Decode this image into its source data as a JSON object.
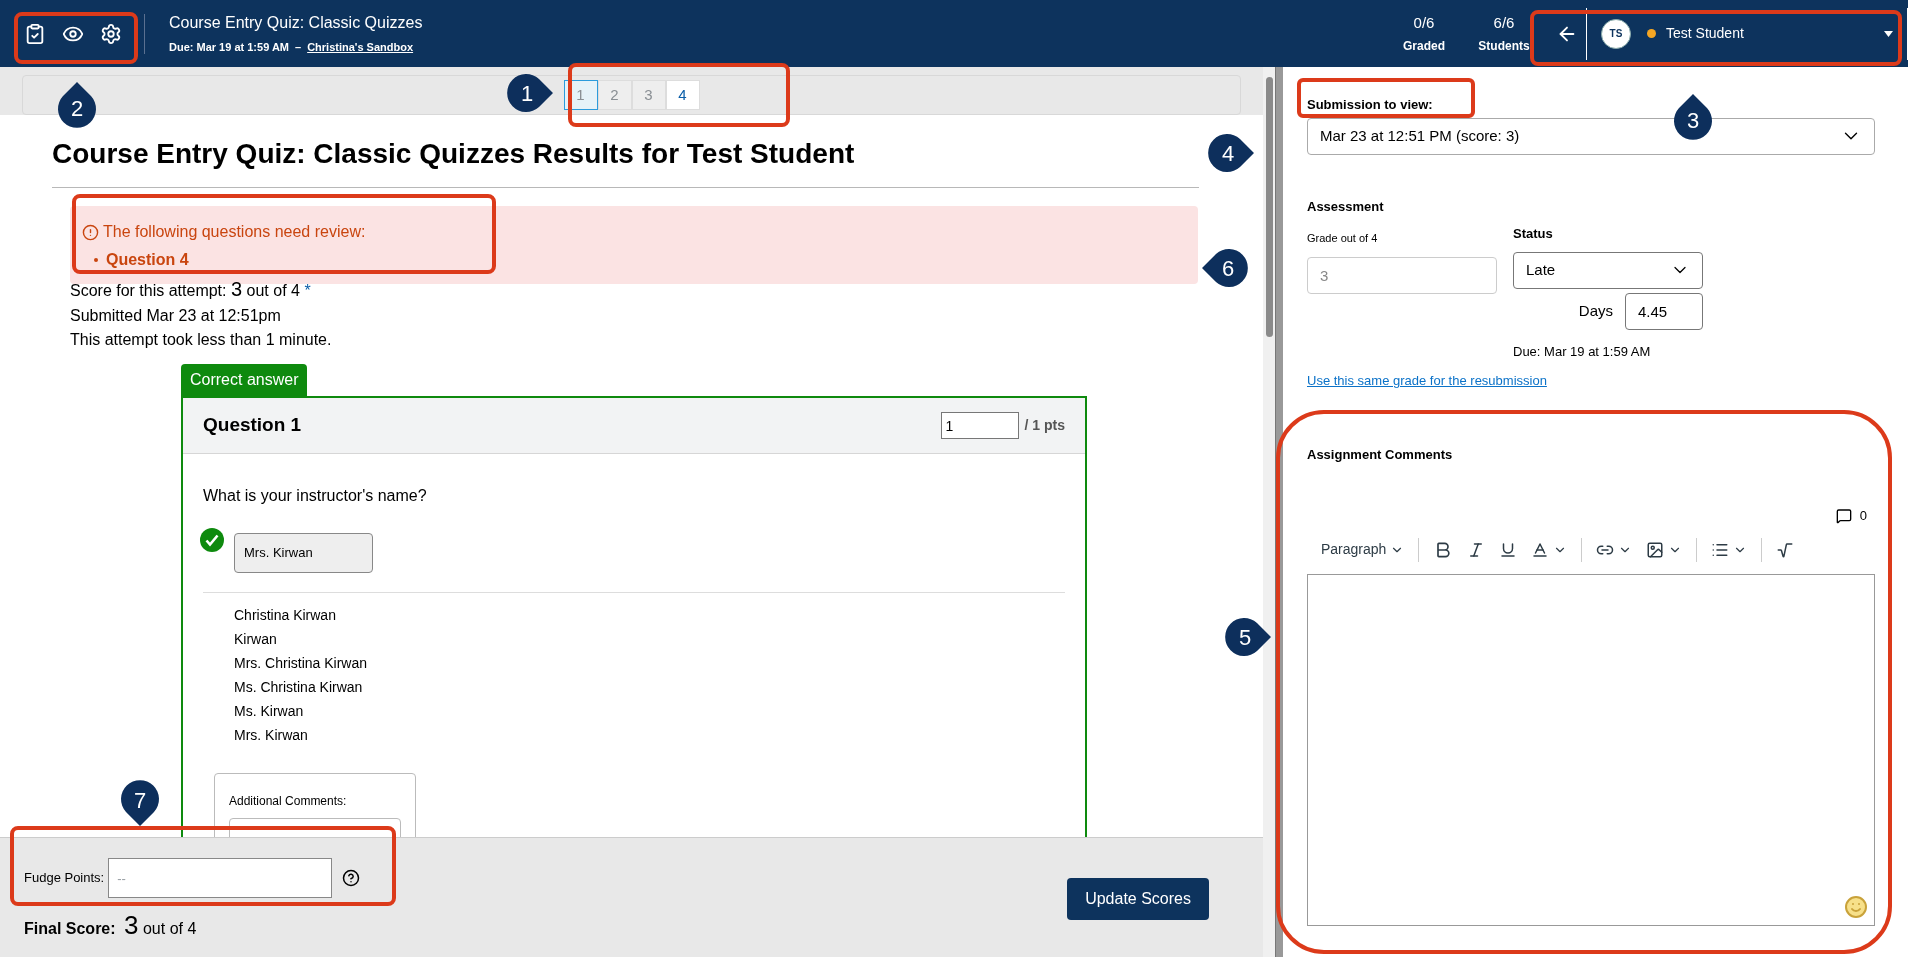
{
  "header": {
    "title": "Course Entry Quiz: Classic Quizzes",
    "due": "Due: Mar 19 at 1:59 AM",
    "separator": "–",
    "course_link": "Christina's Sandbox",
    "stats": [
      {
        "value": "0/6",
        "label": "Graded"
      },
      {
        "value": "6/6",
        "label": "Students"
      }
    ],
    "student": {
      "initials": "TS",
      "name": "Test Student"
    }
  },
  "pagination": [
    {
      "label": "1",
      "selected": true,
      "needs_review": false
    },
    {
      "label": "2",
      "selected": false,
      "needs_review": false
    },
    {
      "label": "3",
      "selected": false,
      "needs_review": false
    },
    {
      "label": "4",
      "selected": false,
      "needs_review": true
    }
  ],
  "results": {
    "title": "Course Entry Quiz: Classic Quizzes Results for Test Student",
    "review_heading": "The following questions need review:",
    "review_items": [
      "Question 4"
    ],
    "score_label": "Score for this attempt:",
    "score_value": "3",
    "score_suffix": "out of 4",
    "score_mark": "*",
    "submitted": "Submitted Mar 23 at 12:51pm",
    "duration": "This attempt took less than 1 minute."
  },
  "question": {
    "badge": "Correct answer",
    "title": "Question 1",
    "points_value": "1",
    "points_suffix": "/ 1 pts",
    "prompt": "What is your instructor's name?",
    "answer": "Mrs. Kirwan",
    "correct": true,
    "accepted_answers": [
      "Christina Kirwan",
      "Kirwan",
      "Mrs. Christina Kirwan",
      "Ms. Christina Kirwan",
      "Ms. Kirwan",
      "Mrs. Kirwan"
    ],
    "comments_label": "Additional Comments:"
  },
  "footer": {
    "fudge_label": "Fudge Points:",
    "fudge_placeholder": "--",
    "final_label": "Final Score:",
    "final_value": "3",
    "final_suffix": "out of 4",
    "button": "Update Scores"
  },
  "sidebar": {
    "submission_label": "Submission to view:",
    "submission_value": "Mar 23 at 12:51 PM (score: 3)",
    "assessment_heading": "Assessment",
    "grade_label": "Grade out of 4",
    "grade_value": "3",
    "status_label": "Status",
    "status_value": "Late",
    "days_label": "Days",
    "days_value": "4.45",
    "due": "Due: Mar 19 at 1:59 AM",
    "link": "Use this same grade for the resubmission",
    "comments_heading": "Assignment Comments",
    "comment_count": "0",
    "block_format": "Paragraph"
  },
  "callouts": [
    {
      "label": "1"
    },
    {
      "label": "2"
    },
    {
      "label": "3"
    },
    {
      "label": "4"
    },
    {
      "label": "5"
    },
    {
      "label": "6"
    },
    {
      "label": "7"
    }
  ]
}
